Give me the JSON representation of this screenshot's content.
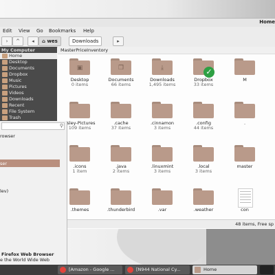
{
  "window": {
    "title": "Home"
  },
  "menubar": [
    "Edit",
    "View",
    "Go",
    "Bookmarks",
    "Help"
  ],
  "toolbar": {
    "crumb_home": "wes",
    "crumb_current": "Downloads"
  },
  "sidebar": {
    "header": "My Computer",
    "items": [
      {
        "label": "Home",
        "selected": true
      },
      {
        "label": "Desktop"
      },
      {
        "label": "Documents"
      },
      {
        "label": "Dropbox"
      },
      {
        "label": "Music"
      },
      {
        "label": "Pictures"
      },
      {
        "label": "Videos"
      },
      {
        "label": "Downloads"
      },
      {
        "label": "Recent"
      },
      {
        "label": "File System"
      },
      {
        "label": "Trash"
      }
    ]
  },
  "pathbar": "MasterPriceInventory",
  "items": [
    {
      "name": "Desktop",
      "count": "0 items",
      "glyph": "▣"
    },
    {
      "name": "Documents",
      "count": "66 items",
      "glyph": "❐"
    },
    {
      "name": "Downloads",
      "count": "1,495 items",
      "glyph": "⤓"
    },
    {
      "name": "Dropbox",
      "count": "33 items",
      "glyph": "",
      "badge": "check"
    },
    {
      "name": "M",
      "count": "",
      "glyph": ""
    },
    {
      "name": "",
      "count": "",
      "glyph": ""
    },
    {
      "name": "esley-Pictures",
      "count": "109 items",
      "glyph": ""
    },
    {
      "name": ".cache",
      "count": "37 items",
      "glyph": ""
    },
    {
      "name": ".cinnamon",
      "count": "3 items",
      "glyph": ""
    },
    {
      "name": ".config",
      "count": "44 items",
      "glyph": ""
    },
    {
      "name": ".",
      "count": "",
      "glyph": ""
    },
    {
      "name": "",
      "count": "",
      "glyph": ""
    },
    {
      "name": ".icons",
      "count": "1 item",
      "glyph": ""
    },
    {
      "name": ".java",
      "count": "2 items",
      "glyph": ""
    },
    {
      "name": ".linuxmint",
      "count": "3 items",
      "glyph": ""
    },
    {
      "name": ".local",
      "count": "3 items",
      "glyph": ""
    },
    {
      "name": "master",
      "count": "",
      "glyph": ""
    },
    {
      "name": "",
      "count": "",
      "glyph": ""
    },
    {
      "name": ".themes",
      "count": "",
      "glyph": ""
    },
    {
      "name": ".thunderbird",
      "count": "",
      "glyph": ""
    },
    {
      "name": ".var",
      "count": "",
      "glyph": ""
    },
    {
      "name": ".weather",
      "count": "",
      "glyph": ""
    },
    {
      "name": "con",
      "count": "",
      "glyph": "",
      "doc": true
    }
  ],
  "status": "48 items, Free sp",
  "start_menu": {
    "lines": [
      "rowser",
      "ser",
      "lev)"
    ],
    "app_title": "Firefox Web Browser",
    "app_desc": "e the World Wide Web"
  },
  "taskbar": [
    {
      "label": "[Amazon - Google ...",
      "color": "#e2453c"
    },
    {
      "label": "[N944 National Cy...",
      "color": "#e2453c"
    },
    {
      "label": "Home",
      "color": "#b99a8a",
      "active": true
    }
  ]
}
